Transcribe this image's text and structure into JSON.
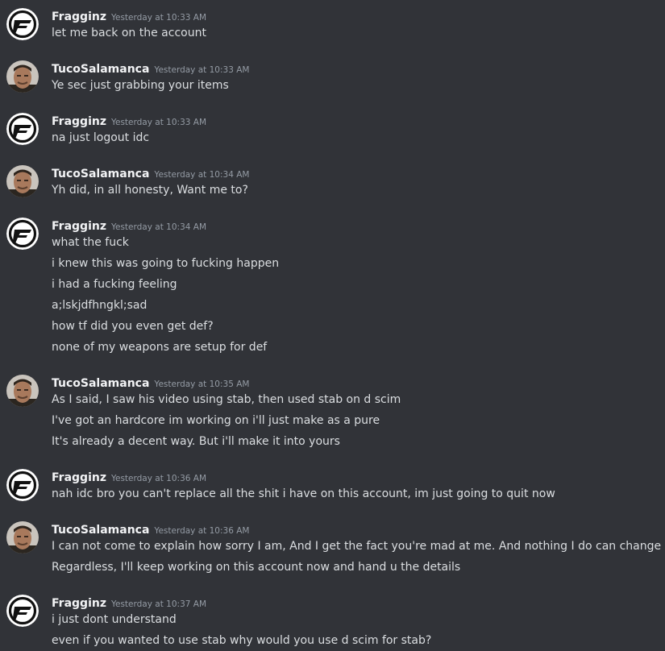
{
  "users": {
    "fragginz": {
      "name": "Fragginz",
      "avatar_icon": "fragginz-logo-icon"
    },
    "tuco": {
      "name": "TucoSalamanca",
      "avatar_icon": "user-photo-avatar"
    }
  },
  "messages": [
    {
      "author": "Fragginz",
      "timestamp": "Yesterday at 10:33 AM",
      "lines": [
        "let me back on the account"
      ]
    },
    {
      "author": "TucoSalamanca",
      "timestamp": "Yesterday at 10:33 AM",
      "lines": [
        "Ye sec just grabbing your items"
      ]
    },
    {
      "author": "Fragginz",
      "timestamp": "Yesterday at 10:33 AM",
      "lines": [
        "na just logout idc"
      ]
    },
    {
      "author": "TucoSalamanca",
      "timestamp": "Yesterday at 10:34 AM",
      "lines": [
        "Yh did, in all honesty, Want me to?"
      ]
    },
    {
      "author": "Fragginz",
      "timestamp": "Yesterday at 10:34 AM",
      "lines": [
        "what the fuck",
        "i knew this was going to fucking happen",
        "i had a fucking feeling",
        "a;lskjdfhngkl;sad",
        "how tf did you even get def?",
        "none of my weapons are setup for def"
      ]
    },
    {
      "author": "TucoSalamanca",
      "timestamp": "Yesterday at 10:35 AM",
      "lines": [
        "As I said, I saw his video using stab, then used stab on d scim",
        "I've got an hardcore im working on i'll just make as a pure",
        "It's already a decent way. But i'll make it into yours"
      ]
    },
    {
      "author": "Fragginz",
      "timestamp": "Yesterday at 10:36 AM",
      "lines": [
        "nah idc bro you can't replace all the shit i have on this account, im just going to quit now"
      ]
    },
    {
      "author": "TucoSalamanca",
      "timestamp": "Yesterday at 10:36 AM",
      "lines": [
        "I can not come to explain how sorry I am, And I get the fact you're mad at me. And nothing I do can change it",
        "Regardless, I'll keep working on this account now and hand u the details"
      ]
    },
    {
      "author": "Fragginz",
      "timestamp": "Yesterday at 10:37 AM",
      "lines": [
        "i just dont understand",
        "even if you wanted to use stab why would you use d scim for stab?"
      ]
    }
  ]
}
